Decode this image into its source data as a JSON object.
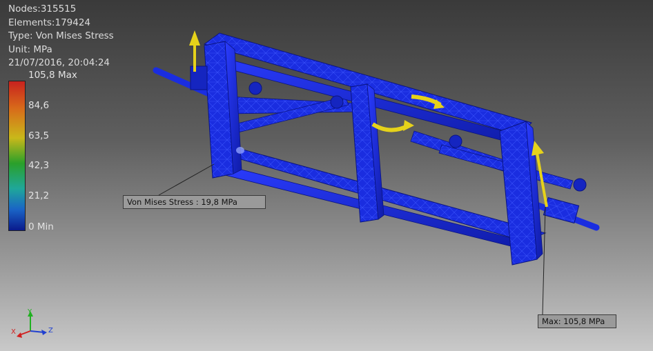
{
  "info": {
    "nodes": "Nodes:315515",
    "elements": "Elements:179424",
    "type": "Type: Von Mises Stress",
    "unit": "Unit: MPa",
    "timestamp": "21/07/2016, 20:04:24"
  },
  "legend": {
    "max_label": "105,8 Max",
    "ticks": [
      "84,6",
      "63,5",
      "42,3",
      "21,2"
    ],
    "min_label": "0 Min",
    "colors": [
      "#c8221e",
      "#d86a1a",
      "#c9b81a",
      "#2aa02a",
      "#1fa79a",
      "#1a64c6",
      "#0a1a8c"
    ]
  },
  "probes": {
    "von_mises": "Von Mises Stress : 19,8 MPa",
    "max": "Max: 105,8 MPa"
  },
  "triad": {
    "x": "X",
    "y": "Y",
    "z": "Z"
  },
  "colors": {
    "mesh_blue": "#1a2de0",
    "load_arrow_yellow": "#e6d21a"
  }
}
